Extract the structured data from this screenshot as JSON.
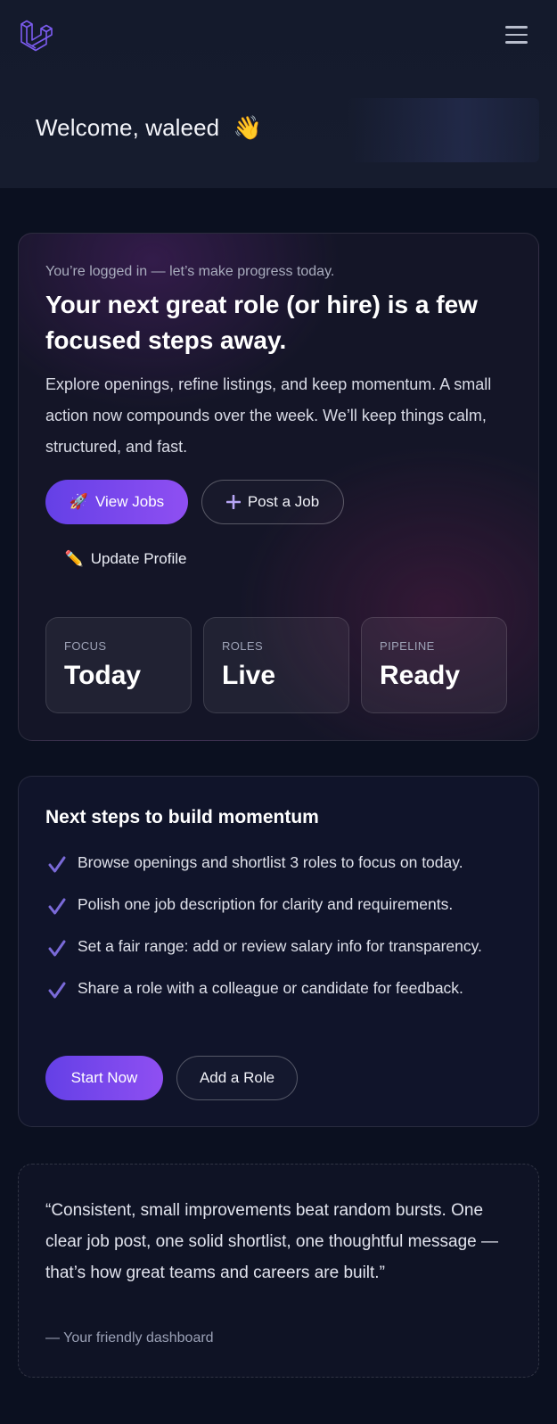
{
  "header": {
    "logo_icon": "laravel-logo-icon",
    "menu_icon": "hamburger-menu-icon",
    "welcome_text": "Welcome, waleed",
    "welcome_emoji": "👋"
  },
  "hero": {
    "kicker": "You’re logged in — let’s make progress today.",
    "headline": "Your next great role (or hire) is a few focused steps away.",
    "description": "Explore openings, refine listings, and keep momentum. A small action now compounds over the week. We’ll keep things calm, structured, and fast.",
    "buttons": {
      "view_jobs": {
        "icon": "🚀",
        "label": "View Jobs"
      },
      "post_job": {
        "icon": "plus-icon",
        "label": "Post a Job"
      },
      "update_profile": {
        "icon": "✏️",
        "label": "Update Profile"
      }
    },
    "stats": [
      {
        "label": "FOCUS",
        "value": "Today"
      },
      {
        "label": "ROLES",
        "value": "Live"
      },
      {
        "label": "PIPELINE",
        "value": "Ready"
      }
    ]
  },
  "steps": {
    "title": "Next steps to build momentum",
    "items": [
      "Browse openings and shortlist 3 roles to focus on today.",
      "Polish one job description for clarity and requirements.",
      "Set a fair range: add or review salary info for transparency.",
      "Share a role with a colleague or candidate for feedback."
    ],
    "start_label": "Start Now",
    "add_role_label": "Add a Role"
  },
  "quote": {
    "text": "“Consistent, small improvements beat random bursts. One clear job post, one solid shortlist, one thoughtful message — that’s how great teams and careers are built.”",
    "signature": "— Your friendly dashboard"
  },
  "colors": {
    "accent": "#6c47e8",
    "accent_end": "#8f4ff2",
    "background": "#0b1020",
    "check": "#7a6ad8"
  }
}
